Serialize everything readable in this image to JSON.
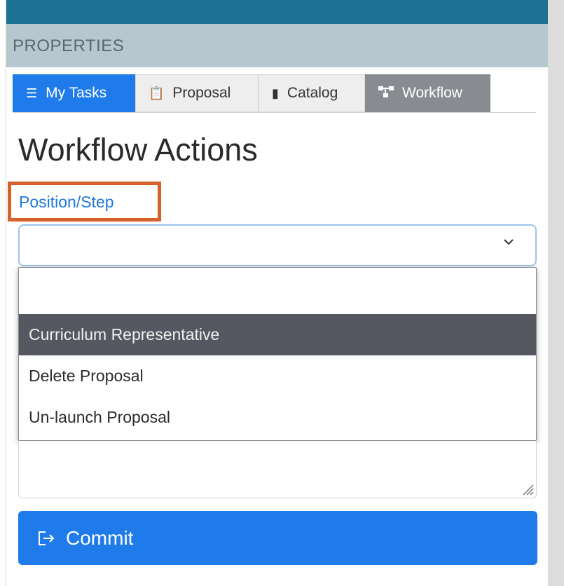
{
  "panel": {
    "title": "PROPERTIES"
  },
  "tabs": [
    {
      "label": "My Tasks",
      "icon": "tasks-list-icon",
      "active_color": "#1e7be9"
    },
    {
      "label": "Proposal",
      "icon": "clipboard-icon"
    },
    {
      "label": "Catalog",
      "icon": "book-icon"
    },
    {
      "label": "Workflow",
      "icon": "workflow-icon",
      "selected_color": "#888c90"
    }
  ],
  "workflow": {
    "heading": "Workflow Actions",
    "position_label": "Position/Step",
    "select_value": "",
    "options": [
      "",
      "Curriculum Representative",
      "Delete Proposal",
      "Un-launch Proposal"
    ],
    "highlighted_option": "Curriculum Representative",
    "commit_label": "Commit",
    "commit_icon": "sign-out-icon"
  },
  "colors": {
    "top_strip": "#1d7193",
    "panel_bar": "#b7c7cf",
    "accent_blue": "#1e7be9",
    "highlight_box": "#d4622a",
    "option_highlight": "#555761"
  }
}
